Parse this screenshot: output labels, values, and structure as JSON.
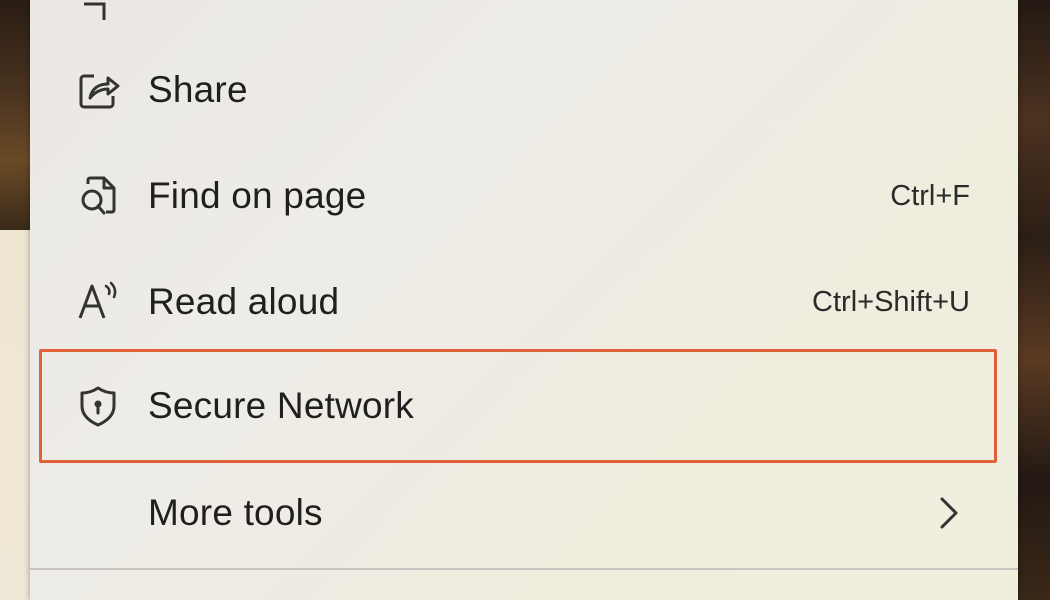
{
  "menu": {
    "items": [
      {
        "id": "share",
        "label": "Share",
        "shortcut": "",
        "icon": "share-icon"
      },
      {
        "id": "find-on-page",
        "label": "Find on page",
        "shortcut": "Ctrl+F",
        "icon": "find-on-page-icon"
      },
      {
        "id": "read-aloud",
        "label": "Read aloud",
        "shortcut": "Ctrl+Shift+U",
        "icon": "read-aloud-icon"
      },
      {
        "id": "secure-network",
        "label": "Secure Network",
        "shortcut": "",
        "icon": "shield-icon"
      },
      {
        "id": "more-tools",
        "label": "More tools",
        "shortcut": "",
        "icon": "chevron-right-icon"
      }
    ]
  },
  "colors": {
    "highlight_border": "#e0603a",
    "menu_background": "#eeece7",
    "text": "#1f1f1f"
  }
}
